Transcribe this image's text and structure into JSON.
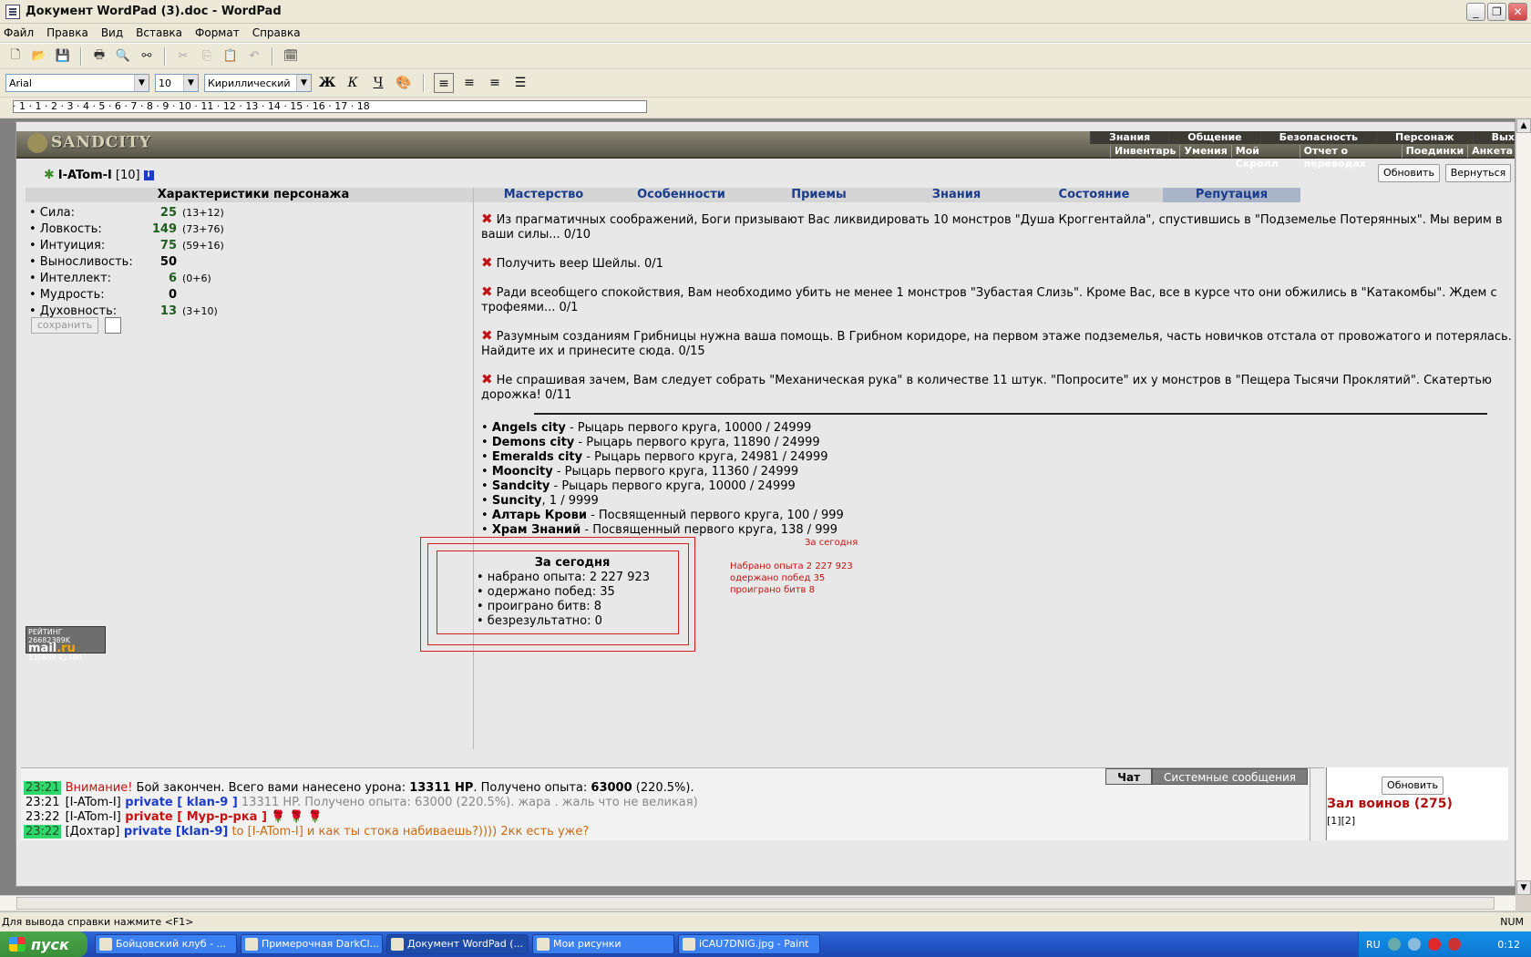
{
  "window": {
    "title": "Документ WordPad (3).doc - WordPad"
  },
  "menu": [
    "Файл",
    "Правка",
    "Вид",
    "Вставка",
    "Формат",
    "Справка"
  ],
  "format": {
    "font": "Arial",
    "size": "10",
    "charset": "Кириллический",
    "bold": "Ж",
    "italic": "К",
    "underline": "Ч"
  },
  "ruler": "· 1 · 1 · 2 · 3 · 4 · 5 · 6 · 7 · 8 · 9 · 10 · 11 · 12 · 13 · 14 · 15 · 16 · 17 · 18",
  "game": {
    "logo": "SANDCITY",
    "nav1": [
      "Знания",
      "Общение",
      "Безопасность",
      "Персонаж",
      "Выход"
    ],
    "nav2": [
      "Инвентарь",
      "Умения",
      "Мой Скролл",
      "Отчет о переводах",
      "Поединки",
      "Анкета"
    ],
    "character": {
      "name": "I-ATom-I",
      "level": "[10]"
    },
    "buttons": {
      "refresh": "Обновить",
      "back": "Вернуться",
      "save": "сохранить"
    },
    "stats_title": "Характеристики персонажа",
    "stats": [
      {
        "name": "• Сила:",
        "value": "25",
        "bonus": "(13+12)"
      },
      {
        "name": "• Ловкость:",
        "value": "149",
        "bonus": "(73+76)"
      },
      {
        "name": "• Интуиция:",
        "value": "75",
        "bonus": "(59+16)"
      },
      {
        "name": "• Выносливость:",
        "value": "50",
        "bonus": ""
      },
      {
        "name": "• Интеллект:",
        "value": "6",
        "bonus": "(0+6)"
      },
      {
        "name": "• Мудрость:",
        "value": "0",
        "bonus": ""
      },
      {
        "name": "• Духовность:",
        "value": "13",
        "bonus": "(3+10)"
      }
    ],
    "tabs": [
      "Мастерство",
      "Особенности",
      "Приемы",
      "Знания",
      "Состояние",
      "Репутация"
    ],
    "quests": [
      "Из прагматичных соображений, Боги призывают Вас ликвидировать 10 монстров \"Душа Кроггентайла\", спустившись в \"Подземелье Потерянных\". Мы верим в ваши силы... 0/10",
      "Получить веер Шейлы. 0/1",
      "Ради всеобщего спокойствия, Вам необходимо убить не менее 1 монстров \"Зубастая Слизь\". Кроме Вас, все в курсе что они обжились в \"Катакомбы\". Ждем с трофеями... 0/1",
      "Разумным созданиям Грибницы нужна ваша помощь. В Грибном коридоре, на первом этаже подземелья, часть новичков отстала от провожатого и потерялась. Найдите их и принесите сюда. 0/15",
      "Не спрашивая зачем, Вам следует собрать \"Механическая рука\" в количестве 11 штук. \"Попросите\" их у монстров в \"Пещера Тысячи Проклятий\". Скатертью дорожка! 0/11"
    ],
    "cities": [
      {
        "city": "Angels city",
        "text": " - Рыцарь первого круга, 10000 / 24999"
      },
      {
        "city": "Demons city",
        "text": " - Рыцарь первого круга, 11890 / 24999"
      },
      {
        "city": "Emeralds city",
        "text": " - Рыцарь первого круга, 24981 / 24999"
      },
      {
        "city": "Mooncity",
        "text": " - Рыцарь первого круга, 11360 / 24999"
      },
      {
        "city": "Sandcity",
        "text": " - Рыцарь первого круга, 10000 / 24999"
      },
      {
        "city": "Suncity",
        "text": ", 1 / 9999"
      },
      {
        "city": "Алтарь Крови",
        "text": " - Посвященный первого круга, 100 / 999"
      },
      {
        "city": "Храм Знаний",
        "text": " - Посвященный первого круга, 138 / 999"
      }
    ],
    "today": {
      "title": "За сегодня",
      "lines": [
        "• набрано опыта: 2 227 923",
        "• одержано побед: 35",
        "• проиграно битв: 8",
        "• безрезультатно: 0"
      ]
    },
    "red_note": {
      "title": "За сегодня",
      "lines": [
        "Набрано опыта 2 227 923",
        "одержано побед 35",
        "проиграно битв 8"
      ]
    },
    "rating": {
      "label": "РЕЙТИНГ",
      "values": [
        "26682389K",
        "13583K",
        "42380"
      ],
      "brand": "mail",
      "brand_tld": ".ru"
    },
    "chat": {
      "tabs": [
        "Чат",
        "Системные сообщения"
      ],
      "lines": [
        {
          "time": "23:21",
          "p1": "Внимание!",
          "p2": " Бой закончен. Всего вами нанесено урона: ",
          "p3": "13311 HP",
          "p4": ". Получено опыта: ",
          "p5": "63000",
          "p6": " (220.5%)."
        },
        {
          "time": "23:21",
          "p1": "[I-ATom-I]",
          "p2": " private [ klan-9 ]",
          "p3": " 13311 HP. Получено опыта: 63000 (220.5%). жара . жаль что не великая)"
        },
        {
          "time": "23:22",
          "p1": "[I-ATom-I]",
          "p2": " private [ Мур-р-рка ]",
          "p3": " 🌹 🌹 🌹"
        },
        {
          "time": "23:22",
          "p1": "[Дохтар]",
          "p2": " private [klan-9]",
          "p3": " to [I-ATom-I] и как ты стока набиваешь?)))) 2кк есть уже?"
        }
      ],
      "side_refresh": "Обновить",
      "hall": "Зал воинов (275)",
      "hall_sub": "[1][2]"
    }
  },
  "status": {
    "help": "Для вывода справки нажмите <F1>",
    "num": "NUM"
  },
  "taskbar": {
    "start": "пуск",
    "tasks": [
      "Бойцовский клуб - ...",
      "Примерочная DarkCl...",
      "Документ WordPad (...",
      "Мои рисунки",
      "iCAU7DNIG.jpg - Paint"
    ],
    "lang": "RU",
    "clock": "0:12"
  }
}
